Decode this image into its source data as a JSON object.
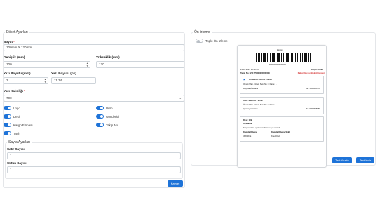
{
  "left_panel": {
    "legend": "Etiket Ayarları",
    "size_label": "Boyut",
    "size_value": "100mm X 120mm",
    "width_label": "Genişlik (mm)",
    "width_value": "100",
    "height_label": "Yükseklik (mm)",
    "height_value": "120",
    "font_size_mm_label": "Yazı Boyutu (mm)",
    "font_size_mm_value": "3",
    "font_size_pt_label": "Yazı Boyutu (px)",
    "font_size_pt_value": "11.34",
    "thickness_label": "Yazı Kalınlığı",
    "thickness_value": "700",
    "toggles_left": [
      "Logo",
      "Desi",
      "Kargo Firması",
      "Tarih"
    ],
    "toggles_right": [
      "Ürün",
      "Gönderici",
      "Takip No"
    ],
    "page_settings": {
      "legend": "Sayfa Ayarları",
      "rows_label": "Satır Sayısı",
      "rows_value": "1",
      "cols_label": "Sütun Sayısı",
      "cols_value": "1"
    },
    "save_button": "Kaydet"
  },
  "right_panel": {
    "legend": "Ön izleme",
    "bulk_toggle": "Toplu Ön İzleme",
    "label": {
      "logo_text": "kargo",
      "barcode_number": "0000000000000000",
      "date": "21.05.2025 16:48:49",
      "carrier": "Kargo Şirketi",
      "tracking": "Takip No: ST1770000000000000",
      "warning": "Kabul Öncesi Stok Alınmıştır",
      "sender_title": "Gönderici: Ahmet Yılmaz",
      "sender_addr1": "Örnek Mah. Örnek Sok. No: 1 Daire: 1",
      "sender_addr2": "Beşiktaş/İstanbul",
      "sender_tel": "Tel: 5555555555",
      "recv_title": "Alıcı: Mehmet Yılmaz",
      "recv_addr1": "Örnek Mah. Örnek Sok. No: 1 Daire: 1",
      "recv_addr2": "Çankaya/Ankara",
      "recv_tel": "Tel: 5555555555",
      "desi": "Desi: 1.38",
      "desc_title": "Açıklama",
      "desc_text": "Kargonuzun açıklaması burada yer alacak.",
      "pay_title": "Kapıda Ödeme",
      "pay_value": "498.49 ₺",
      "pay_type_title": "Kapıda Ödeme Şekli",
      "pay_type_value": "Kredi Kartı"
    },
    "print_button": "Test Yazdır",
    "save_button": "Test İndir"
  },
  "colors": {
    "accent": "#1e73d8",
    "warning": "#d32f2f"
  }
}
